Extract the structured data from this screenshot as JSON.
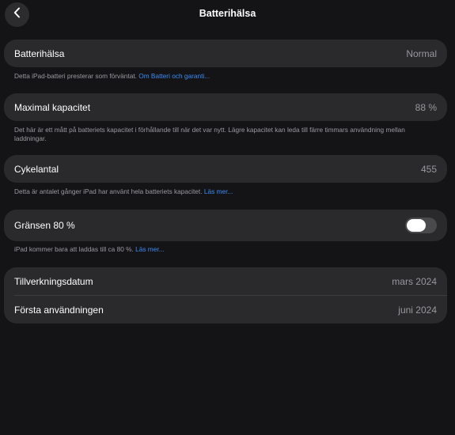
{
  "nav": {
    "title": "Batterihälsa",
    "back_icon": "chevron-left-icon"
  },
  "battery_health": {
    "label": "Batterihälsa",
    "value": "Normal",
    "footnote": "Detta iPad-batteri presterar som förväntat.",
    "footnote_link": "Om Batteri och garanti..."
  },
  "max_capacity": {
    "label": "Maximal kapacitet",
    "value": "88 %",
    "footnote": "Det här är ett mått på batteriets kapacitet i förhållande till när det var nytt. Lägre kapacitet kan leda till färre timmars användning mellan laddningar."
  },
  "cycle_count": {
    "label": "Cykelantal",
    "value": "455",
    "footnote": "Detta är antalet gånger iPad har använt hela batteriets kapacitet.",
    "footnote_link": "Läs mer..."
  },
  "limit_80": {
    "label": "Gränsen 80 %",
    "enabled": false,
    "footnote": "iPad kommer bara att laddas till ca 80 %.",
    "footnote_link": "Läs mer..."
  },
  "dates": {
    "manufacture_label": "Tillverkningsdatum",
    "manufacture_value": "mars 2024",
    "first_use_label": "Första användningen",
    "first_use_value": "juni 2024"
  },
  "colors": {
    "background": "#141416",
    "card": "#2a2a2c",
    "link": "#3a8ef6",
    "secondary_text": "#98989d"
  }
}
